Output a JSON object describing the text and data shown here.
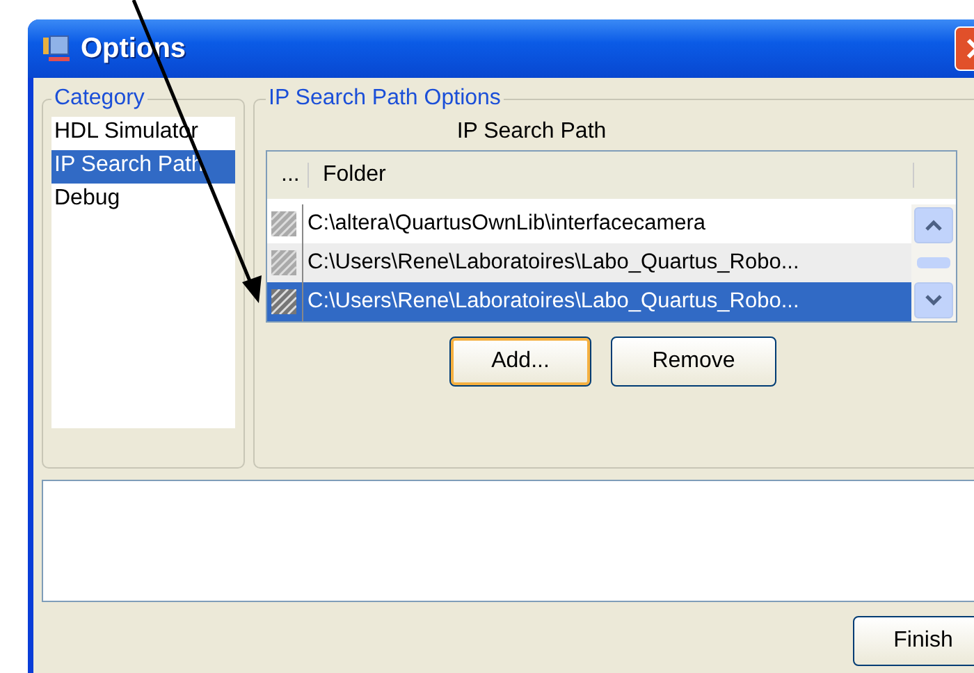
{
  "window": {
    "title": "Options"
  },
  "category": {
    "title": "Category",
    "items": [
      {
        "label": "HDL Simulator",
        "selected": false
      },
      {
        "label": "IP Search Path",
        "selected": true
      },
      {
        "label": "Debug",
        "selected": false
      }
    ]
  },
  "options": {
    "title": "IP Search Path Options",
    "table_title": "IP Search Path",
    "columns": [
      "...",
      "Folder"
    ],
    "rows": [
      {
        "folder": "C:\\altera\\QuartusOwnLib\\interfacecamera",
        "selected": false
      },
      {
        "folder": "C:\\Users\\Rene\\Laboratoires\\Labo_Quartus_Robo...",
        "selected": false
      },
      {
        "folder": "C:\\Users\\Rene\\Laboratoires\\Labo_Quartus_Robo...",
        "selected": true
      }
    ],
    "buttons": [
      {
        "label": "Add...",
        "default": true
      },
      {
        "label": "Remove",
        "default": false
      }
    ]
  },
  "finish": "Finish"
}
